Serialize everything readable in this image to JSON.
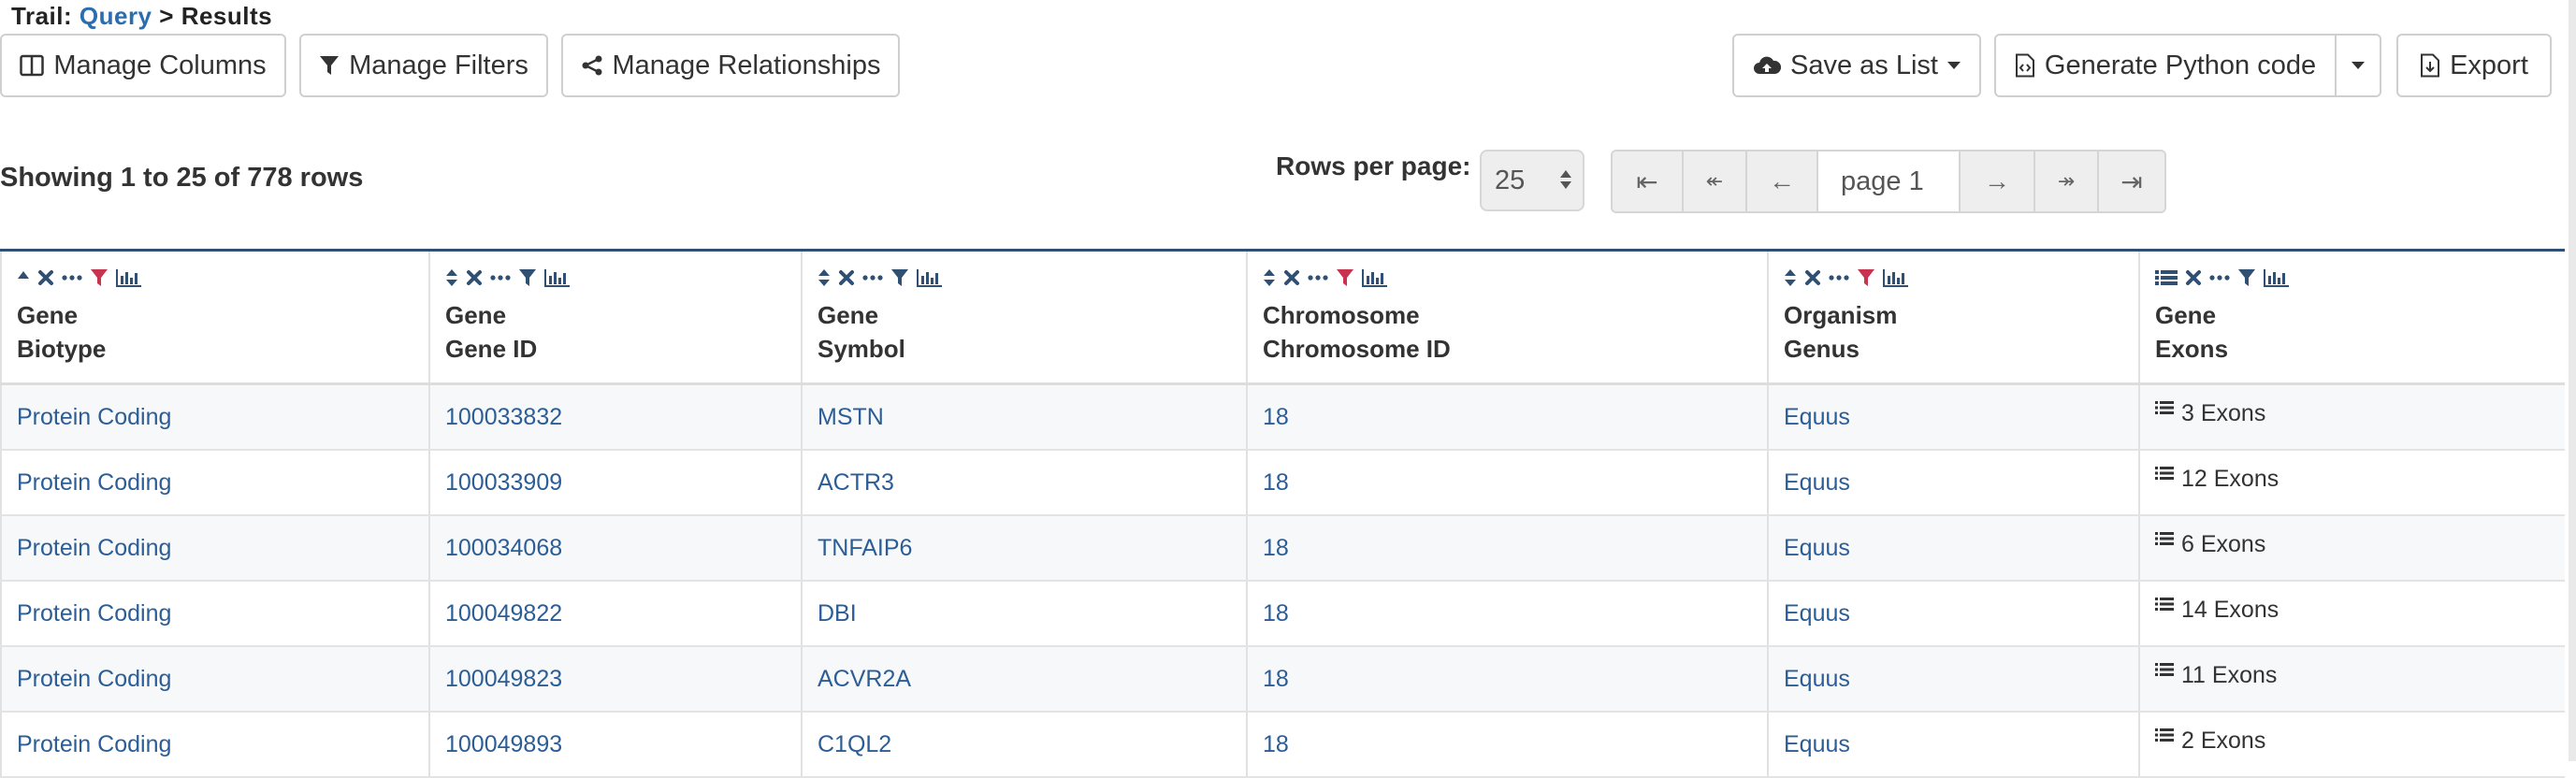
{
  "trail": {
    "label": "Trail:",
    "link": "Query",
    "separator": ">",
    "current": "Results"
  },
  "toolbar": {
    "manage_columns": "Manage Columns",
    "manage_filters": "Manage Filters",
    "manage_relationships": "Manage Relationships",
    "save_as_list": "Save as List",
    "generate_code": "Generate Python code",
    "export": "Export"
  },
  "summary": {
    "showing": "Showing 1 to 25 of 778 rows"
  },
  "pagination": {
    "rows_per_page_label": "Rows per page:",
    "rows_per_page_value": "25",
    "first": "⇤",
    "prev_fast": "↞",
    "prev": "←",
    "page_value": "page 1",
    "next": "→",
    "next_fast": "↠",
    "last": "⇥"
  },
  "table": {
    "columns": [
      {
        "line1": "Gene",
        "line2": "Biotype",
        "filter_active": true,
        "sort": "asc"
      },
      {
        "line1": "Gene",
        "line2": "Gene ID",
        "filter_active": false,
        "sort": "none"
      },
      {
        "line1": "Gene",
        "line2": "Symbol",
        "filter_active": false,
        "sort": "none"
      },
      {
        "line1": "Chromosome",
        "line2": "Chromosome ID",
        "filter_active": true,
        "sort": "none"
      },
      {
        "line1": "Organism",
        "line2": "Genus",
        "filter_active": true,
        "sort": "none"
      },
      {
        "line1": "Gene",
        "line2": "Exons",
        "filter_active": false,
        "sort": "list"
      }
    ],
    "rows": [
      {
        "biotype": "Protein Coding",
        "gene_id": "100033832",
        "symbol": "MSTN",
        "chromosome": "18",
        "genus": "Equus",
        "exons": "3 Exons"
      },
      {
        "biotype": "Protein Coding",
        "gene_id": "100033909",
        "symbol": "ACTR3",
        "chromosome": "18",
        "genus": "Equus",
        "exons": "12 Exons"
      },
      {
        "biotype": "Protein Coding",
        "gene_id": "100034068",
        "symbol": "TNFAIP6",
        "chromosome": "18",
        "genus": "Equus",
        "exons": "6 Exons"
      },
      {
        "biotype": "Protein Coding",
        "gene_id": "100049822",
        "symbol": "DBI",
        "chromosome": "18",
        "genus": "Equus",
        "exons": "14 Exons"
      },
      {
        "biotype": "Protein Coding",
        "gene_id": "100049823",
        "symbol": "ACVR2A",
        "chromosome": "18",
        "genus": "Equus",
        "exons": "11 Exons"
      },
      {
        "biotype": "Protein Coding",
        "gene_id": "100049893",
        "symbol": "C1QL2",
        "chromosome": "18",
        "genus": "Equus",
        "exons": "2 Exons"
      }
    ]
  },
  "colors": {
    "link": "#2b5d96",
    "filter_active": "#c8334f",
    "icon": "#2f4f73",
    "header_rule": "#2f4f73"
  },
  "icons": [
    "columns-icon",
    "filter-icon",
    "share-icon",
    "cloud-upload-icon",
    "file-code-icon",
    "file-export-icon",
    "sort-icon",
    "remove-icon",
    "ellipsis-icon",
    "bar-chart-icon",
    "list-icon"
  ]
}
